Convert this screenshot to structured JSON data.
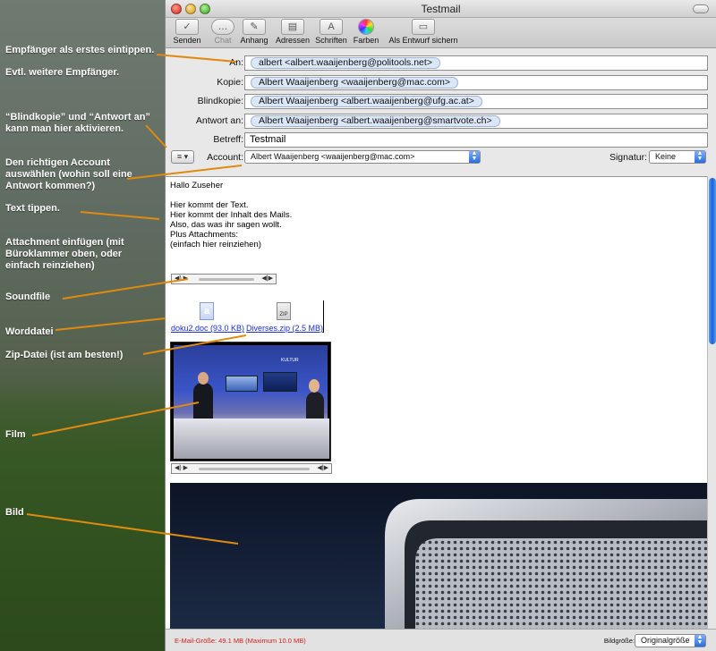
{
  "annotations": [
    {
      "text": "Empfänger als erstes eintippen."
    },
    {
      "text": "Evtl. weitere Empfänger."
    },
    {
      "text": "“Blindkopie” und “Antwort an” kann man hier aktivieren."
    },
    {
      "text": "Den richtigen Account auswählen (wohin soll eine Antwort kommen?)"
    },
    {
      "text": "Text tippen."
    },
    {
      "text": "Attachment einfügen (mit Büroklammer oben, oder einfach reinziehen)"
    },
    {
      "text": "Soundfile"
    },
    {
      "text": "Worddatei"
    },
    {
      "text": "Zip-Datei (ist am besten!)"
    },
    {
      "text": "Film"
    },
    {
      "text": "Bild"
    }
  ],
  "window": {
    "title": "Testmail"
  },
  "toolbar": {
    "senden": "Senden",
    "chat": "Chat",
    "anhang": "Anhang",
    "adressen": "Adressen",
    "schriften": "Schriften",
    "farben": "Farben",
    "entwurf": "Als Entwurf sichern"
  },
  "headers": {
    "an_label": "An:",
    "an_value": "albert <albert.waaijenberg@politools.net>",
    "kopie_label": "Kopie:",
    "kopie_value": "Albert Waaijenberg <waaijenberg@mac.com>",
    "blind_label": "Blindkopie:",
    "blind_value": "Albert Waaijenberg <albert.waaijenberg@ufg.ac.at>",
    "antwort_label": "Antwort an:",
    "antwort_value": "Albert Waaijenberg <albert.waaijenberg@smartvote.ch>",
    "betreff_label": "Betreff:",
    "betreff_value": "Testmail",
    "account_label": "Account:",
    "account_value": "Albert Waaijenberg <waaijenberg@mac.com>",
    "signatur_label": "Signatur:",
    "signatur_value": "Keine"
  },
  "body": {
    "lines": [
      "Hallo Zuseher",
      "",
      "Hier kommt der Text.",
      "Hier kommt der Inhalt des Mails.",
      "Also, das was ihr sagen wollt.",
      "Plus Attachments:",
      "(einfach hier reinziehen)"
    ],
    "attachment_doc": "doku2.doc (93.0 KB)",
    "attachment_zip": "Diverses.zip (2.5 MB)",
    "zip_icon_label": "ZIP",
    "film_overlay": "KULTUR"
  },
  "status": {
    "size": "E-Mail-Größe: 49.1 MB (Maximum 10.0 MB)",
    "bildgroesse_label": "Bildgröße:",
    "bildgroesse_value": "Originalgröße"
  },
  "colors": {
    "annotation_arrow": "#e08a10",
    "size_warning": "#d0201a",
    "link": "#1a2fd0"
  }
}
